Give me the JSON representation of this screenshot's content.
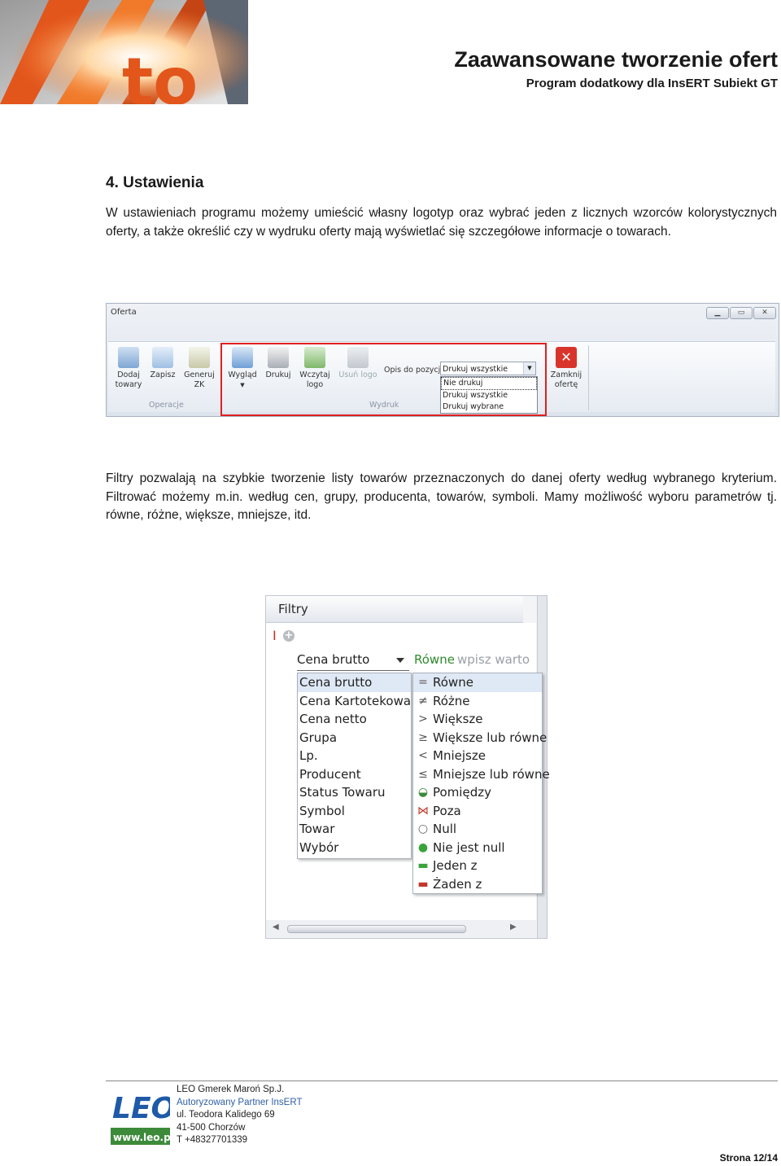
{
  "header": {
    "title": "Zaawansowane tworzenie ofert",
    "subtitle": "Program dodatkowy dla InsERT Subiekt GT"
  },
  "section": {
    "heading": "4. Ustawienia",
    "para1": "W ustawieniach programu możemy umieścić własny logotyp oraz wybrać jeden z licznych wzorców kolorystycznych oferty, a także określić czy w wydruku oferty mają wyświetlać się szczegółowe informacje o towarach.",
    "para2": "Filtry pozwalają na szybkie tworzenie listy towarów przeznaczonych do danej oferty według wybranego kryterium. Filtrować możemy m.in. według cen, grupy, producenta, towarów, symboli. Mamy możliwość wyboru parametrów tj. równe, różne, większe, mniejsze, itd."
  },
  "oferta_window": {
    "title": "Oferta",
    "buttons": {
      "dodaj": [
        "Dodaj",
        "towary"
      ],
      "zapisz": "Zapisz",
      "generuj": [
        "Generuj",
        "ZK"
      ],
      "wyglad": "Wygląd",
      "drukuj": "Drukuj",
      "wczytaj": [
        "Wczytaj",
        "logo"
      ],
      "usun": "Usuń logo",
      "zamknij": [
        "Zamknij",
        "ofertę"
      ]
    },
    "groups": {
      "operacje": "Operacje",
      "wydruk": "Wydruk"
    },
    "opis_label": "Opis do pozycji",
    "opis_value": "Drukuj wszystkie",
    "opis_options": [
      "Nie drukuj",
      "Drukuj wszystkie",
      "Drukuj wybrane"
    ]
  },
  "filtry_panel": {
    "title": "Filtry",
    "field_value": "Cena brutto",
    "operator_value": "Równe",
    "value_placeholder": "wpisz warto",
    "fields": [
      "Cena brutto",
      "Cena Kartotekowa",
      "Cena netto",
      "Grupa",
      "Lp.",
      "Producent",
      "Status Towaru",
      "Symbol",
      "Towar",
      "Wybór"
    ],
    "operators": [
      {
        "label": "Równe",
        "icon": "equals-icon",
        "glyph": "="
      },
      {
        "label": "Różne",
        "icon": "not-equal-icon",
        "glyph": "≠"
      },
      {
        "label": "Większe",
        "icon": "greater-icon",
        "glyph": ">"
      },
      {
        "label": "Większe lub równe",
        "icon": "greater-equal-icon",
        "glyph": "≥"
      },
      {
        "label": "Mniejsze",
        "icon": "less-icon",
        "glyph": "<"
      },
      {
        "label": "Mniejsze lub równe",
        "icon": "less-equal-icon",
        "glyph": "≤"
      },
      {
        "label": "Pomiędzy",
        "icon": "between-icon",
        "glyph": "◒"
      },
      {
        "label": "Poza",
        "icon": "outside-icon",
        "glyph": "⋈"
      },
      {
        "label": "Null",
        "icon": "null-icon",
        "glyph": "○"
      },
      {
        "label": "Nie jest null",
        "icon": "not-null-icon",
        "glyph": "●"
      },
      {
        "label": "Jeden z",
        "icon": "one-of-icon",
        "glyph": "▬"
      },
      {
        "label": "Żaden z",
        "icon": "none-of-icon",
        "glyph": "▬"
      }
    ]
  },
  "footer": {
    "logo_text": "www.leo.pl",
    "company": "LEO Gmerek Maroń Sp.J.",
    "partner": "Autoryzowany Partner InsERT",
    "street": "ul. Teodora Kalidego 69",
    "city": "41-500 Chorzów",
    "phone": "T +48327701339",
    "page": "Strona 12/14"
  },
  "colors": {
    "accent_red": "#e02020",
    "link_blue": "#2f5fa6",
    "green": "#2e8b2e"
  }
}
